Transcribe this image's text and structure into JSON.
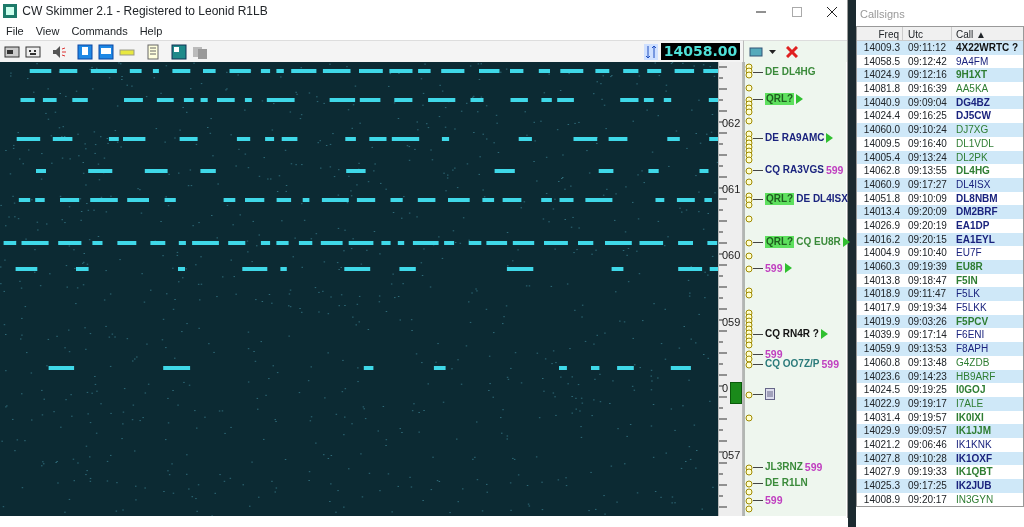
{
  "window": {
    "title": "CW Skimmer 2.1 - Registered to Leonid R1LB"
  },
  "menu": [
    "File",
    "View",
    "Commands",
    "Help"
  ],
  "frequency": "14058.00",
  "scale_labels": [
    "062",
    "061",
    "060",
    "059",
    "0",
    "057"
  ],
  "decodes": [
    {
      "segments": [
        {
          "kind": "text",
          "text": "DE DL4HG",
          "color": "#3a8a3a"
        }
      ],
      "arrow": false
    },
    {
      "segments": [
        {
          "kind": "qrl",
          "text": "QRL?",
          "color": "#5ee05e"
        }
      ],
      "arrow": true
    },
    {
      "segments": [
        {
          "kind": "text",
          "text": "DE RA9AMC",
          "color": "#1a237e"
        }
      ],
      "arrow": true
    },
    {
      "segments": [
        {
          "kind": "text",
          "text": "CQ RA3VGS",
          "color": "#1a237e"
        },
        {
          "kind": "report",
          "text": "599",
          "color": "#c040c0"
        }
      ],
      "arrow": false
    },
    {
      "segments": [
        {
          "kind": "qrl",
          "text": "QRL?",
          "color": "#5ee05e"
        },
        {
          "kind": "text",
          "text": "DE DL4ISX",
          "color": "#1a237e"
        }
      ],
      "arrow": false
    },
    {
      "segments": [
        {
          "kind": "qrl",
          "text": "QRL?",
          "color": "#5ee05e"
        },
        {
          "kind": "text",
          "text": "CQ EU8R",
          "color": "#3a8a3a"
        }
      ],
      "arrow": true
    },
    {
      "segments": [
        {
          "kind": "report",
          "text": "599",
          "color": "#c040c0"
        }
      ],
      "arrow": true
    },
    {
      "segments": [
        {
          "kind": "text",
          "text": "CQ RN4R ?",
          "color": "#111111"
        }
      ],
      "arrow": true
    },
    {
      "segments": [
        {
          "kind": "report",
          "text": "599",
          "color": "#c040c0"
        }
      ],
      "arrow": false
    },
    {
      "segments": [
        {
          "kind": "text",
          "text": "CQ OO7Z/P",
          "color": "#2a7a7a"
        },
        {
          "kind": "report",
          "text": "599",
          "color": "#c040c0"
        }
      ],
      "arrow": false
    },
    {
      "segments": [
        {
          "kind": "doc"
        }
      ],
      "arrow": false
    },
    {
      "segments": [
        {
          "kind": "text",
          "text": "JL3RNZ",
          "color": "#3a8a3a"
        },
        {
          "kind": "report",
          "text": "599",
          "color": "#c040c0"
        }
      ],
      "arrow": false
    },
    {
      "segments": [
        {
          "kind": "text",
          "text": "DE R1LN",
          "color": "#3a8a3a"
        }
      ],
      "arrow": false
    },
    {
      "segments": [
        {
          "kind": "report",
          "text": "599",
          "color": "#c040c0"
        }
      ],
      "arrow": false
    }
  ],
  "callsigns": {
    "title": "Callsigns",
    "columns": [
      "Freq",
      "Utc",
      "Call ▲"
    ],
    "rows": [
      {
        "freq": "14009.3",
        "utc": "09:11:12",
        "call": "4X22WRTC ?",
        "color": "#111111",
        "bold": true
      },
      {
        "freq": "14058.5",
        "utc": "09:12:42",
        "call": "9A4FM",
        "color": "#1a237e",
        "bold": false
      },
      {
        "freq": "14024.9",
        "utc": "09:12:16",
        "call": "9H1XT",
        "color": "#2e7d32",
        "bold": true
      },
      {
        "freq": "14081.8",
        "utc": "09:16:39",
        "call": "AA5KA",
        "color": "#2e7d32",
        "bold": false
      },
      {
        "freq": "14040.9",
        "utc": "09:09:04",
        "call": "DG4BZ",
        "color": "#1a237e",
        "bold": true
      },
      {
        "freq": "14024.4",
        "utc": "09:16:25",
        "call": "DJ5CW",
        "color": "#1a237e",
        "bold": true
      },
      {
        "freq": "14060.0",
        "utc": "09:10:24",
        "call": "DJ7XG",
        "color": "#2e7d32",
        "bold": false
      },
      {
        "freq": "14009.5",
        "utc": "09:16:40",
        "call": "DL1VDL",
        "color": "#2e7d32",
        "bold": false
      },
      {
        "freq": "14005.4",
        "utc": "09:13:24",
        "call": "DL2PK",
        "color": "#2e7d32",
        "bold": false
      },
      {
        "freq": "14062.8",
        "utc": "09:13:55",
        "call": "DL4HG",
        "color": "#2e7d32",
        "bold": true
      },
      {
        "freq": "14060.9",
        "utc": "09:17:27",
        "call": "DL4ISX",
        "color": "#1a237e",
        "bold": false
      },
      {
        "freq": "14051.8",
        "utc": "09:10:09",
        "call": "DL8NBM",
        "color": "#1a237e",
        "bold": true
      },
      {
        "freq": "14013.4",
        "utc": "09:20:09",
        "call": "DM2BRF",
        "color": "#1a237e",
        "bold": true
      },
      {
        "freq": "14026.9",
        "utc": "09:20:19",
        "call": "EA1DP",
        "color": "#1a237e",
        "bold": true
      },
      {
        "freq": "14016.2",
        "utc": "09:20:15",
        "call": "EA1EYL",
        "color": "#1a237e",
        "bold": true
      },
      {
        "freq": "14004.9",
        "utc": "09:10:40",
        "call": "EU7F",
        "color": "#1a237e",
        "bold": false
      },
      {
        "freq": "14060.3",
        "utc": "09:19:39",
        "call": "EU8R",
        "color": "#2e7d32",
        "bold": true
      },
      {
        "freq": "14013.8",
        "utc": "09:18:47",
        "call": "F5IN",
        "color": "#2e7d32",
        "bold": true
      },
      {
        "freq": "14018.9",
        "utc": "09:11:47",
        "call": "F5LK",
        "color": "#1a237e",
        "bold": false
      },
      {
        "freq": "14017.9",
        "utc": "09:19:34",
        "call": "F5LKK",
        "color": "#1a237e",
        "bold": false
      },
      {
        "freq": "14019.9",
        "utc": "09:03:26",
        "call": "F5PCV",
        "color": "#2e7d32",
        "bold": true
      },
      {
        "freq": "14039.9",
        "utc": "09:17:14",
        "call": "F6ENI",
        "color": "#1a237e",
        "bold": false
      },
      {
        "freq": "14059.9",
        "utc": "09:13:53",
        "call": "F8APH",
        "color": "#1a237e",
        "bold": false
      },
      {
        "freq": "14060.8",
        "utc": "09:13:48",
        "call": "G4ZDB",
        "color": "#2e7d32",
        "bold": false
      },
      {
        "freq": "14023.6",
        "utc": "09:14:23",
        "call": "HB9ARF",
        "color": "#2e7d32",
        "bold": false
      },
      {
        "freq": "14024.5",
        "utc": "09:19:25",
        "call": "I0GOJ",
        "color": "#2e7d32",
        "bold": true
      },
      {
        "freq": "14022.9",
        "utc": "09:19:17",
        "call": "I7ALE",
        "color": "#2e7d32",
        "bold": false
      },
      {
        "freq": "14031.4",
        "utc": "09:19:57",
        "call": "IK0IXI",
        "color": "#2e7d32",
        "bold": true
      },
      {
        "freq": "14029.9",
        "utc": "09:09:57",
        "call": "IK1JJM",
        "color": "#2e7d32",
        "bold": true
      },
      {
        "freq": "14021.2",
        "utc": "09:06:46",
        "call": "IK1KNK",
        "color": "#1a237e",
        "bold": false
      },
      {
        "freq": "14027.8",
        "utc": "09:10:28",
        "call": "IK1OXF",
        "color": "#1a237e",
        "bold": true
      },
      {
        "freq": "14027.9",
        "utc": "09:19:33",
        "call": "IK1QBT",
        "color": "#2e7d32",
        "bold": true
      },
      {
        "freq": "14025.3",
        "utc": "09:17:25",
        "call": "IK2JUB",
        "color": "#1a237e",
        "bold": true
      },
      {
        "freq": "14008.9",
        "utc": "09:20:17",
        "call": "IN3GYN",
        "color": "#2e7d32",
        "bold": false
      }
    ]
  }
}
